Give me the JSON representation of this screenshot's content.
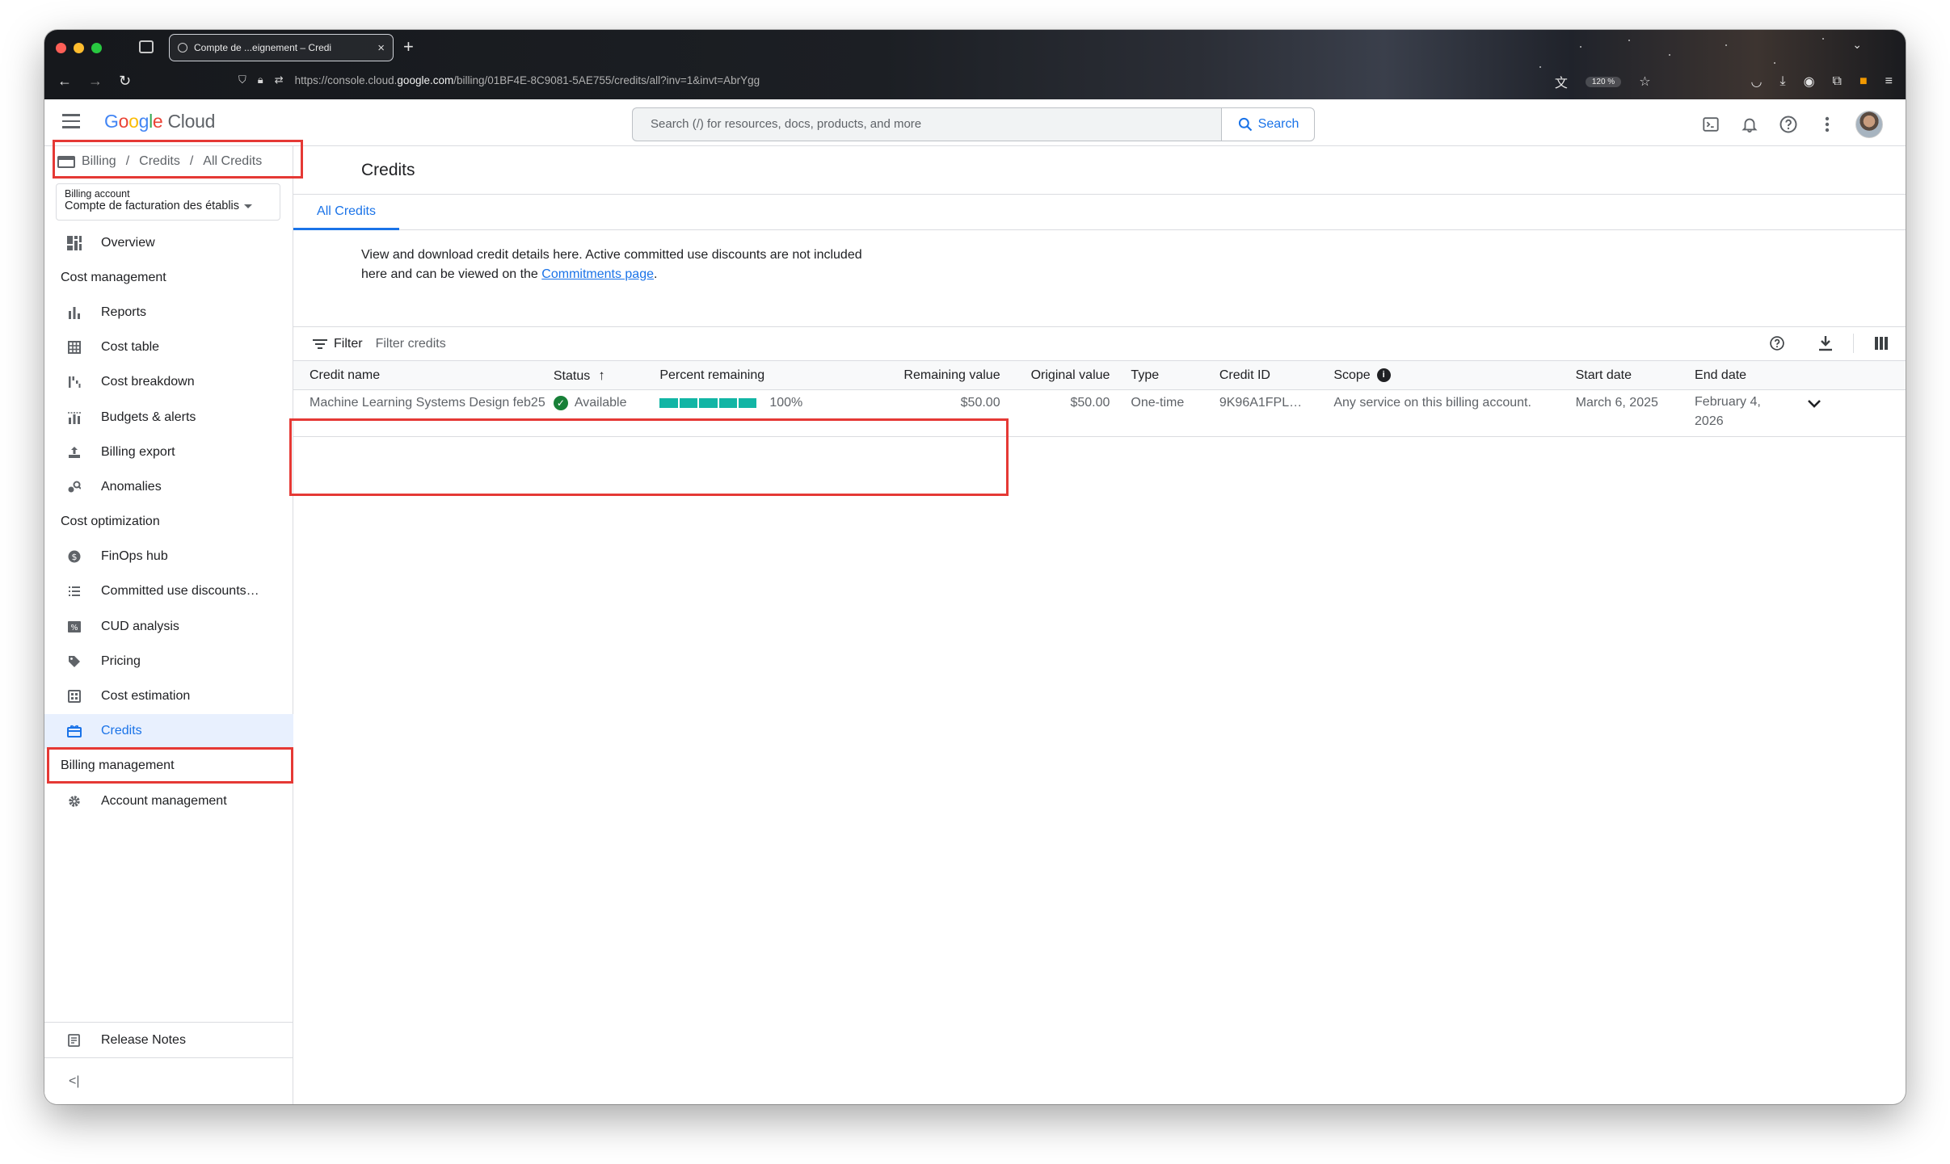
{
  "browser": {
    "tab_title": "Compte de ...eignement – Credi",
    "url_prefix": "https://console.cloud.",
    "url_domain": "google.com",
    "url_path": "/billing/01BF4E-8C9081-5AE755/credits/all?inv=1&invt=AbrYgg",
    "zoom": "120 %"
  },
  "header": {
    "logo_google": [
      "G",
      "o",
      "o",
      "g",
      "l",
      "e"
    ],
    "logo_cloud": "Cloud",
    "search_placeholder": "Search (/) for resources, docs, products, and more",
    "search_button": "Search"
  },
  "breadcrumb": [
    "Billing",
    "Credits",
    "All Credits"
  ],
  "billing_account": {
    "label": "Billing account",
    "value": "Compte de facturation des établis"
  },
  "sidebar": {
    "overview": "Overview",
    "sections": [
      {
        "title": "Cost management",
        "items": [
          "Reports",
          "Cost table",
          "Cost breakdown",
          "Budgets & alerts",
          "Billing export",
          "Anomalies"
        ]
      },
      {
        "title": "Cost optimization",
        "items": [
          "FinOps hub",
          "Committed use discounts…",
          "CUD analysis",
          "Pricing",
          "Cost estimation",
          "Credits"
        ]
      },
      {
        "title": "Billing management",
        "items": [
          "Account management"
        ]
      }
    ],
    "active_item": "Credits",
    "release_notes": "Release Notes"
  },
  "main": {
    "title": "Credits",
    "tab": "All Credits",
    "description_text": "View and download credit details here. Active committed use discounts are not included here and can be viewed on the ",
    "description_link": "Commitments page",
    "description_end": ".",
    "filter_label": "Filter",
    "filter_placeholder": "Filter credits"
  },
  "table": {
    "columns": [
      "Credit name",
      "Status",
      "Percent remaining",
      "Remaining value",
      "Original value",
      "Type",
      "Credit ID",
      "Scope",
      "Start date",
      "End date"
    ],
    "rows": [
      {
        "credit_name": "Machine Learning Systems Design feb25",
        "status": "Available",
        "percent_remaining": 100,
        "percent_label": "100%",
        "remaining_value": "$50.00",
        "original_value": "$50.00",
        "type": "One-time",
        "credit_id": "9K96A1FPL…",
        "scope": "Any service on this billing account.",
        "start_date": "March 6, 2025",
        "end_date_line1": "February 4,",
        "end_date_line2": "2026"
      }
    ]
  },
  "colors": {
    "accent": "#1a73e8",
    "highlight_box": "#e53935",
    "progress": "#12b5a5",
    "status_ok": "#188038"
  }
}
